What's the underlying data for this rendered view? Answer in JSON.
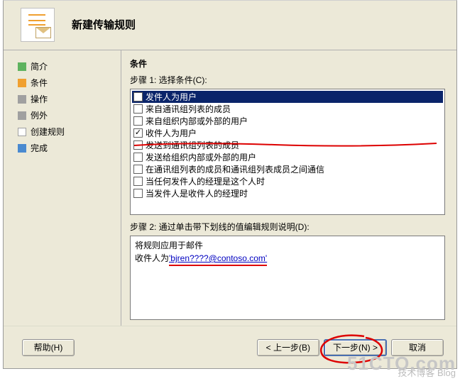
{
  "header": {
    "title": "新建传输规则"
  },
  "sidebar": {
    "items": [
      {
        "label": "简介",
        "color": "sq-green"
      },
      {
        "label": "条件",
        "color": "sq-orange"
      },
      {
        "label": "操作",
        "color": "sq-gray"
      },
      {
        "label": "例外",
        "color": "sq-gray"
      },
      {
        "label": "创建规则",
        "color": "sq-white"
      },
      {
        "label": "完成",
        "color": "sq-blue"
      }
    ]
  },
  "main": {
    "section": "条件",
    "step1_label": "步骤 1: 选择条件(C):",
    "conditions": [
      {
        "label": "发件人为用户",
        "checked": false,
        "selected": true
      },
      {
        "label": "来自通讯组列表的成员",
        "checked": false
      },
      {
        "label": "来自组织内部或外部的用户",
        "checked": false
      },
      {
        "label": "收件人为用户",
        "checked": true
      },
      {
        "label": "发送到通讯组列表的成员",
        "checked": false
      },
      {
        "label": "发送给组织内部或外部的用户",
        "checked": false
      },
      {
        "label": "在通讯组列表的成员和通讯组列表成员之间通信",
        "checked": false
      },
      {
        "label": "当任何发件人的经理是这个人时",
        "checked": false
      },
      {
        "label": "当发件人是收件人的经理时",
        "checked": false
      }
    ],
    "step2_label": "步骤 2: 通过单击带下划线的值编辑规则说明(D):",
    "rule_text": "将规则应用于邮件",
    "recipient_prefix": "收件人为",
    "recipient_link": "'bjren????@contoso.com'"
  },
  "footer": {
    "help": "帮助(H)",
    "back": "< 上一步(B)",
    "next": "下一步(N) >",
    "cancel": "取消"
  },
  "watermark": {
    "big": "51CTO.com",
    "small": "技术博客   Blog"
  }
}
